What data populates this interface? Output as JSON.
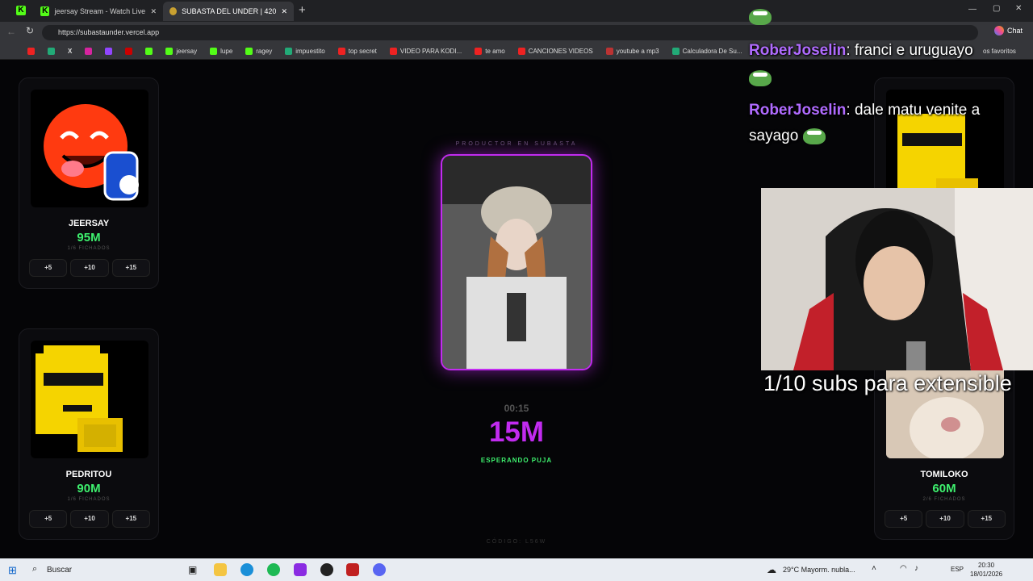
{
  "browser": {
    "tabs": [
      {
        "label": "jeersay Stream - Watch Live o"
      },
      {
        "label": "SUBASTA DEL UNDER | 420"
      }
    ],
    "url": "https://subastaunder.vercel.app",
    "bookmarks": [
      "jeersay",
      "lupe",
      "ragey",
      "impuestito",
      "top secret",
      "VIDEO PARA KODI...",
      "te amo",
      "CANCIONES VIDEOS",
      "youtube a mp3",
      "Calculadora De Su..."
    ],
    "bookmarks_end": "os favoritos",
    "chat_button": "Chat"
  },
  "auction": {
    "label": "PRODUCTOR EN SUBASTA",
    "timer": "00:15",
    "bid": "15M",
    "status": "ESPERANDO PUJA",
    "code": "CÓDIGO: L56W"
  },
  "players": [
    {
      "name": "JEERSAY",
      "amount": "95M",
      "fichados": "1/6 FICHADOS",
      "buttons": [
        "+5",
        "+10",
        "+15"
      ]
    },
    {
      "name": "PEDRITOU",
      "amount": "90M",
      "fichados": "1/6 FICHADOS",
      "buttons": [
        "+5",
        "+10",
        "+15"
      ]
    },
    {
      "name": "TOMILOKO",
      "amount": "60M",
      "fichados": "2/6 FICHADOS",
      "buttons": [
        "+5",
        "+10",
        "+15"
      ]
    }
  ],
  "overlay": {
    "chat": [
      {
        "user": "RoberJoselin",
        "message": "franci e uruguayo"
      },
      {
        "user": "RoberJoselin",
        "message": "dale matu venite a"
      },
      {
        "message": "sayago"
      }
    ],
    "caption": "1/10 subs para extensible"
  },
  "taskbar": {
    "search": "Buscar",
    "weather": "29°C  Mayorm. nubla...",
    "lang": "ESP",
    "time": "20:30",
    "date": "18/01/2026"
  }
}
